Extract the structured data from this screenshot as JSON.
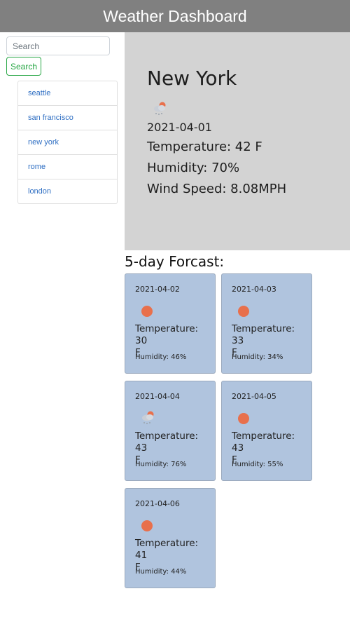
{
  "header": {
    "title": "Weather Dashboard"
  },
  "sidebar": {
    "search_placeholder": "Search",
    "search_button_label": "Search",
    "cities": [
      "seattle",
      "san francisco",
      "new york",
      "rome",
      "london"
    ]
  },
  "current": {
    "city": "New York",
    "icon": "cloud-snow-icon",
    "date": "2021-04-01",
    "temperature": "Temperature: 42 F",
    "humidity": "Humidity: 70%",
    "wind": "Wind Speed: 8.08MPH"
  },
  "forecast": {
    "title": "5-day Forcast:",
    "days": [
      {
        "date": "2021-04-02",
        "icon": "sun-icon",
        "temp_line1": "Temperature: 30",
        "temp_line2": "F",
        "humidity": "Humidity: 46%"
      },
      {
        "date": "2021-04-03",
        "icon": "sun-icon",
        "temp_line1": "Temperature: 33",
        "temp_line2": "F",
        "humidity": "Humidity: 34%"
      },
      {
        "date": "2021-04-04",
        "icon": "cloud-snow-icon",
        "temp_line1": "Temperature: 43",
        "temp_line2": "F",
        "humidity": "Humidity: 76%"
      },
      {
        "date": "2021-04-05",
        "icon": "sun-icon",
        "temp_line1": "Temperature: 43",
        "temp_line2": "F",
        "humidity": "Humidity: 55%"
      },
      {
        "date": "2021-04-06",
        "icon": "sun-icon",
        "temp_line1": "Temperature: 41",
        "temp_line2": "F",
        "humidity": "Humidity: 44%"
      }
    ]
  },
  "colors": {
    "header_bg": "#808080",
    "current_bg": "#d3d3d3",
    "card_bg": "#b0c4de",
    "sun": "#e8704c",
    "link": "#2f6fc3",
    "search_button": "#28a745"
  }
}
